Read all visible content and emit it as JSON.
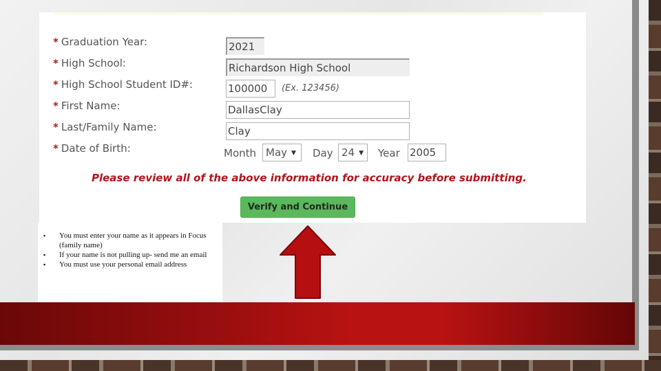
{
  "form": {
    "fields": [
      {
        "label": "Graduation Year:",
        "value": "2021",
        "readonly": true
      },
      {
        "label": "High School:",
        "value": "Richardson High School",
        "readonly": true
      },
      {
        "label": "High School Student ID#:",
        "value": "100000",
        "hint": "(Ex. 123456)"
      },
      {
        "label": "First Name:",
        "value": "DallasClay"
      },
      {
        "label": "Last/Family Name:",
        "value": "Clay"
      },
      {
        "label": "Date of Birth:"
      }
    ],
    "required_marker": "*",
    "dob": {
      "month_label": "Month",
      "month_value": "May",
      "day_label": "Day",
      "day_value": "24",
      "year_label": "Year",
      "year_value": "2005",
      "dropdown_glyph": "▼"
    },
    "warning": "Please review all of the above information for accuracy before submitting.",
    "verify_button": "Verify and Continue"
  },
  "notes": {
    "bullet_glyph": "▪",
    "items": [
      "You must enter your name as it appears in Focus (family name)",
      "If your name is not pulling up- send me an email",
      "You must use your personal email address"
    ]
  },
  "colors": {
    "accent_red": "#b81212",
    "button_green": "#5cb85c",
    "warning_red": "#b0141a"
  }
}
